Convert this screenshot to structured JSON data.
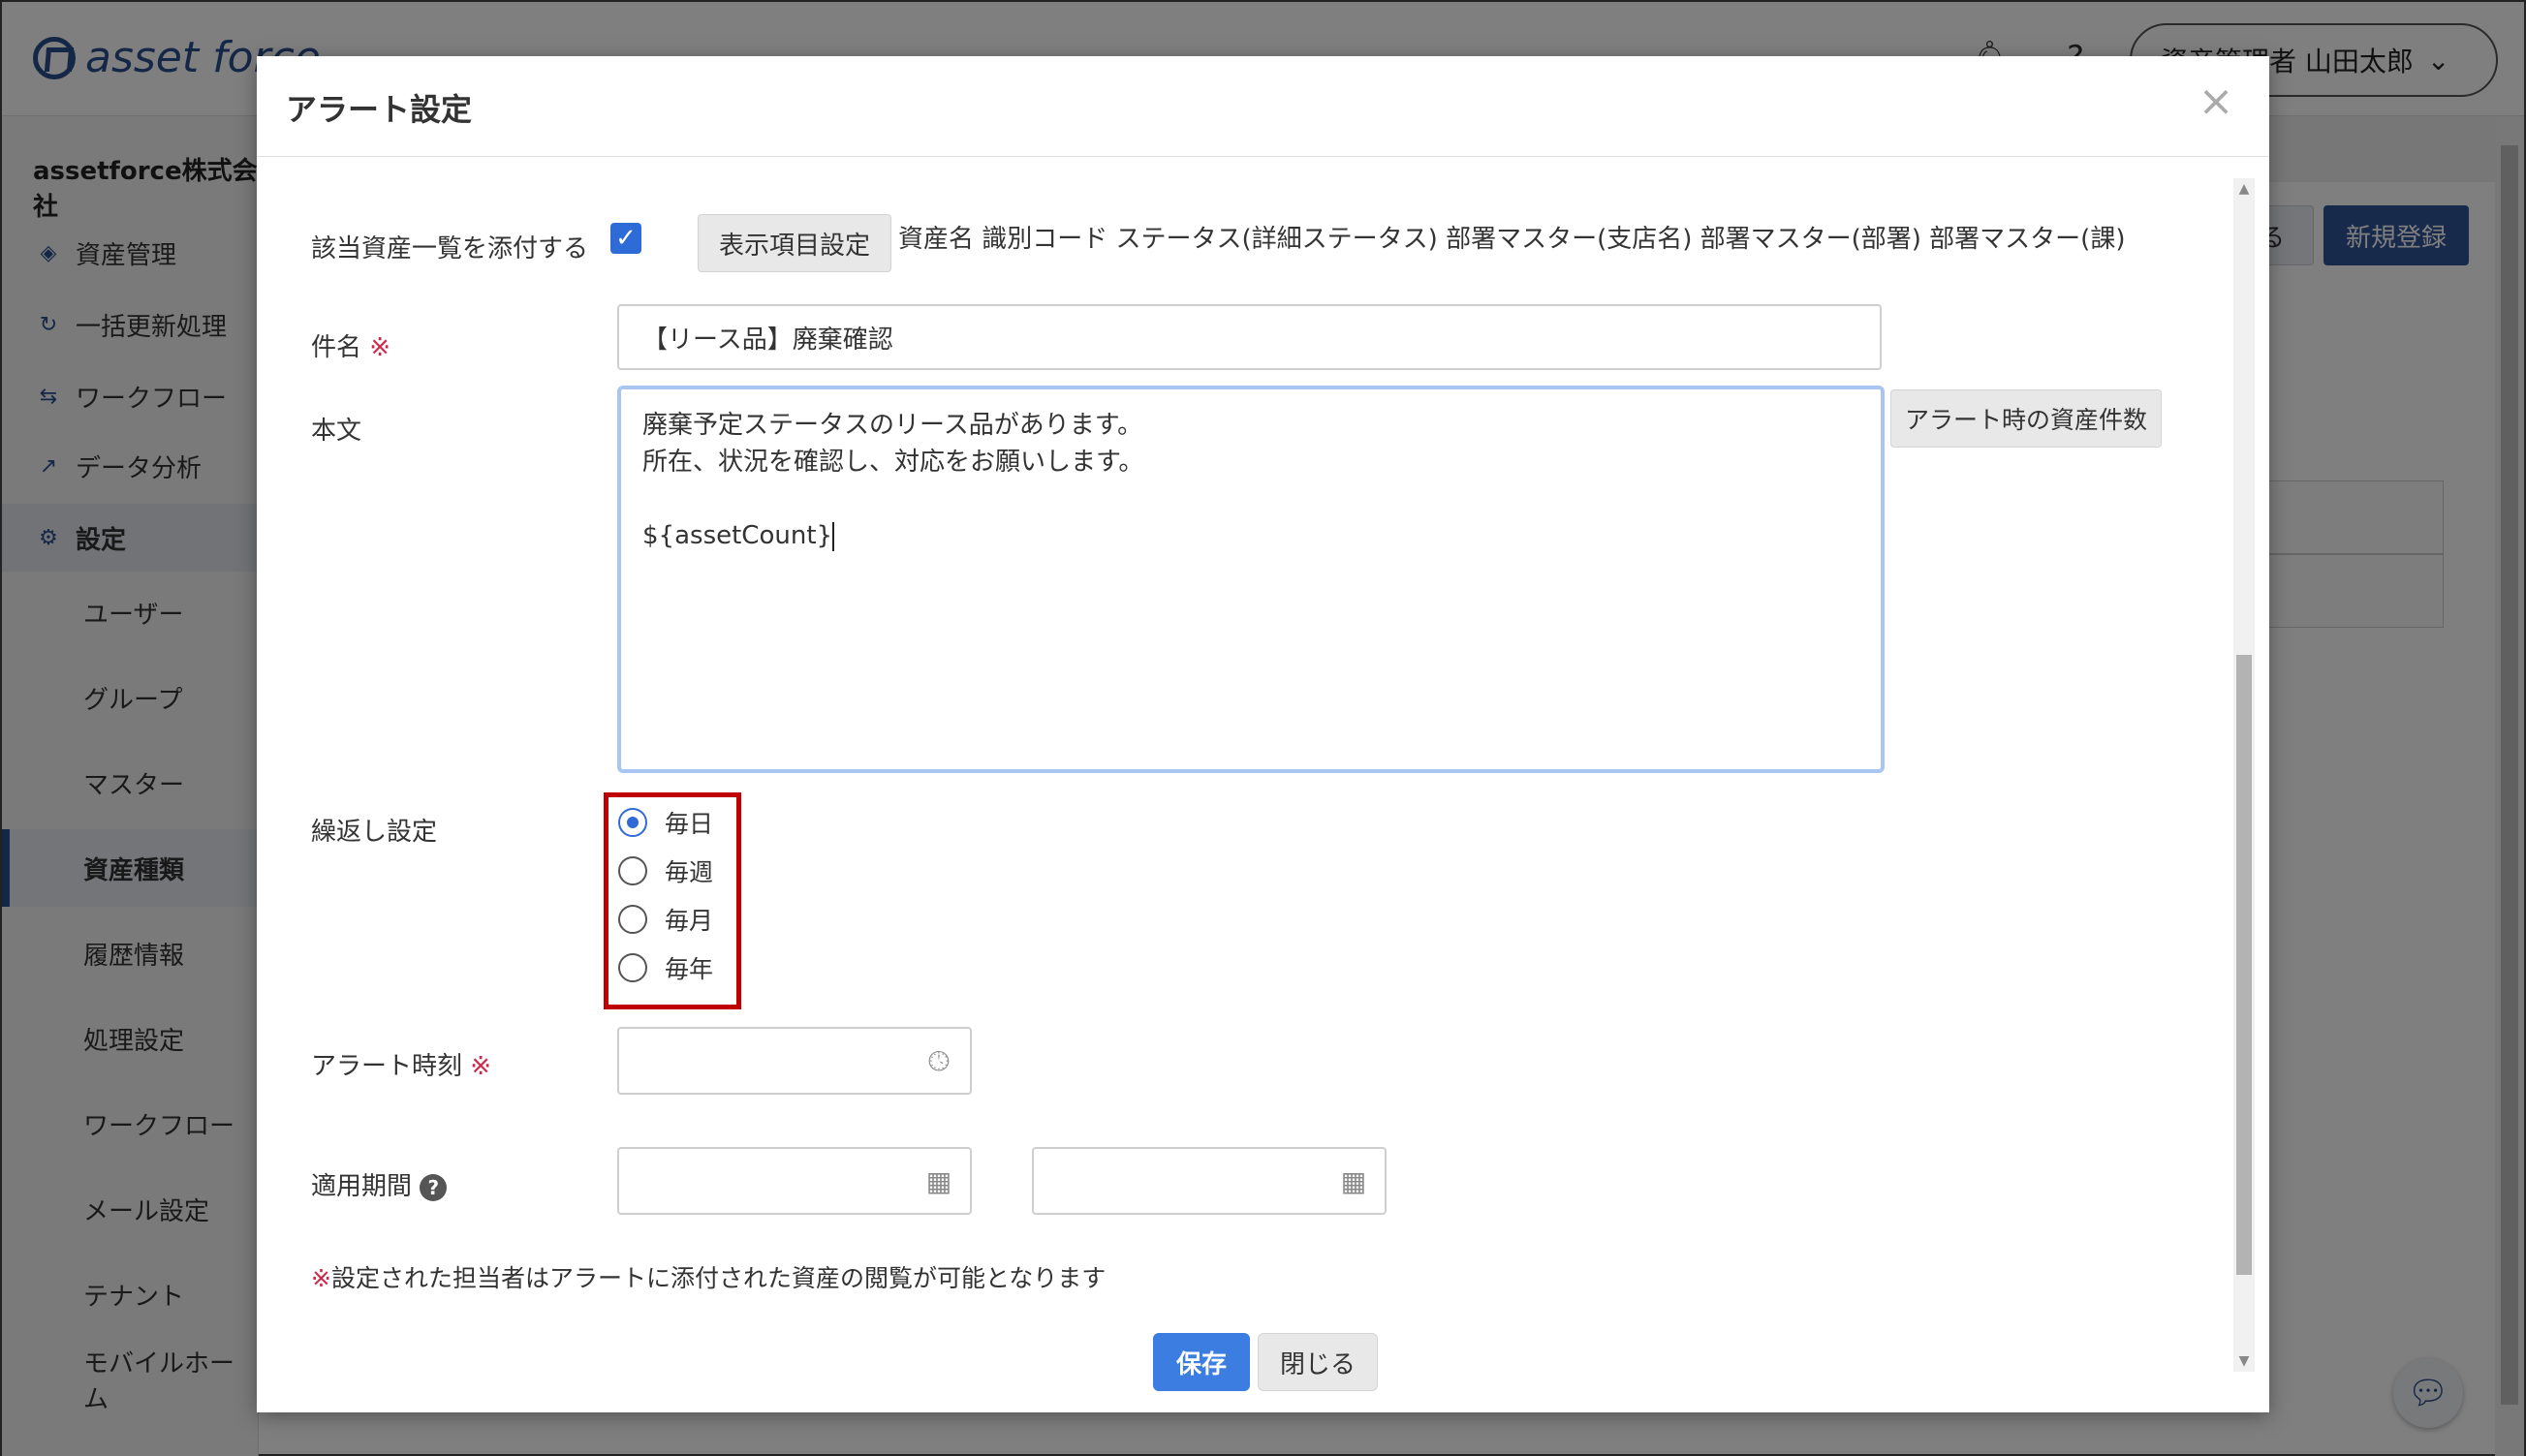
{
  "header": {
    "logo_text": "asset force",
    "user_menu_label": "資産管理者 山田太郎",
    "user_menu_chevron": "⌄"
  },
  "sidebar": {
    "company": "assetforce株式会社",
    "nav": [
      {
        "label": "資産管理",
        "icon": "cube-icon"
      },
      {
        "label": "一括更新処理",
        "icon": "refresh-icon"
      },
      {
        "label": "ワークフロー",
        "icon": "workflow-icon"
      },
      {
        "label": "データ分析",
        "icon": "analytics-icon"
      },
      {
        "label": "設定",
        "icon": "gear-icon"
      }
    ],
    "settings_items": [
      "ユーザー",
      "グループ",
      "マスター",
      "資産種類",
      "履歴情報",
      "処理設定",
      "ワークフロー",
      "メール設定",
      "テナント",
      "モバイルホーム"
    ],
    "selected_item": "資産種類"
  },
  "content": {
    "new_button": "新規登録",
    "other_button": "る"
  },
  "modal": {
    "title": "アラート設定",
    "close_icon": "×",
    "attach": {
      "label": "該当資産一覧を添付する",
      "checked": true,
      "settings_button": "表示項目設定",
      "display_items": "資産名 識別コード ステータス(詳細ステータス) 部署マスター(支店名) 部署マスター(部署) 部署マスター(課)"
    },
    "subject": {
      "label": "件名",
      "required_mark": "※",
      "value": "【リース品】廃棄確認"
    },
    "body": {
      "label": "本文",
      "line1": "廃棄予定ステータスのリース品があります。",
      "line2": "所在、状況を確認し、対応をお願いします。",
      "line3": "${assetCount}",
      "insert_button": "アラート時の資産件数"
    },
    "repeat": {
      "label": "繰返し設定",
      "options": [
        "毎日",
        "毎週",
        "毎月",
        "毎年"
      ],
      "selected": "毎日"
    },
    "alert_time": {
      "label": "アラート時刻",
      "required_mark": "※",
      "value": ""
    },
    "period": {
      "label": "適用期間",
      "help_icon": "?",
      "separator": "〜",
      "start": "",
      "end": ""
    },
    "note_mark": "※",
    "note": "設定された担当者はアラートに添付された資産の閲覧が可能となります",
    "save_button": "保存",
    "close_button": "閉じる"
  },
  "colors": {
    "brand": "#2a4f8f",
    "primary": "#3b7de0",
    "required": "#d0284a",
    "highlight_box": "#c00000"
  }
}
